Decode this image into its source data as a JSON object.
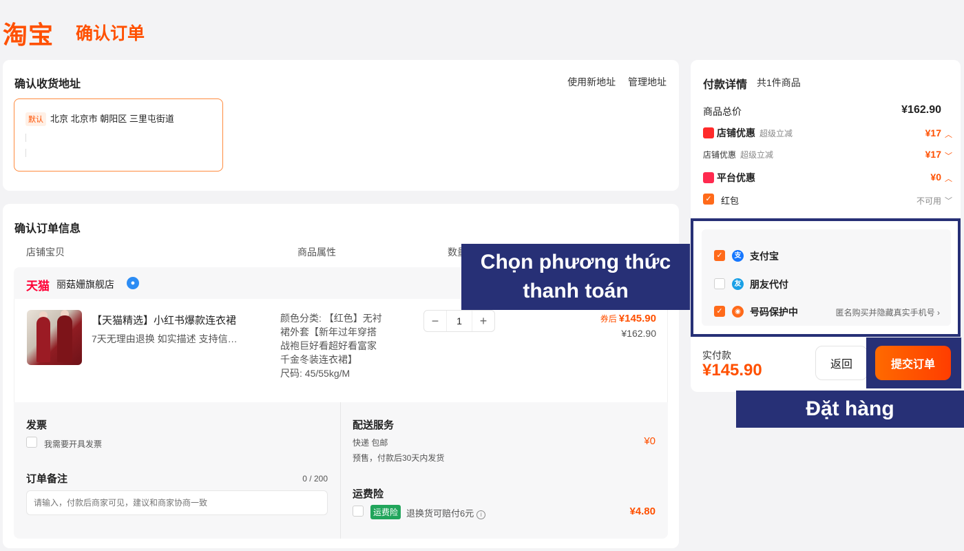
{
  "header": {
    "logo": "淘宝",
    "title": "确认订单"
  },
  "address": {
    "title": "确认收货地址",
    "links": [
      "使用新地址",
      "管理地址"
    ],
    "default_tag": "默认",
    "text": "北京 北京市 朝阳区 三里屯街道"
  },
  "order": {
    "title": "确认订单信息",
    "columns": [
      "店铺宝贝",
      "商品属性",
      "数量"
    ],
    "shop": {
      "brand": "天猫",
      "name": "丽菇姗旗舰店"
    },
    "item": {
      "title": "【天猫精选】小红书爆款连衣裙",
      "sub": "7天无理由退换  如实描述  支持信…",
      "attr_color": "颜色分类: 【红色】无衬裙外套【新年过年穿搭战袍巨好看超好看富家千金冬装连衣裙】",
      "attr_size": "尺码: 45/55kg/M",
      "qty": "1",
      "price_label": "券后",
      "price_new": "¥145.90",
      "price_old": "¥162.90"
    },
    "invoice": {
      "title": "发票",
      "option": "我需要开具发票"
    },
    "note": {
      "title": "订单备注",
      "counter": "0 / 200",
      "placeholder": "请输入，付款后商家可见，建议和商家协商一致"
    },
    "delivery": {
      "title": "配送服务",
      "method": "快递 包邮",
      "presale": "预售，付款后30天内发货",
      "price": "¥0"
    },
    "shipping_insurance": {
      "title": "运费险",
      "tag": "运费险",
      "desc": "退换货可赔付6元",
      "price": "¥4.80"
    }
  },
  "payment": {
    "title": "付款详情",
    "count": "共1件商品",
    "goods_total_label": "商品总价",
    "goods_total": "¥162.90",
    "shop_discount_label": "店铺优惠",
    "shop_discount_sub": "超级立减",
    "shop_discount": "¥17",
    "shop_discount_row_label": "店铺优惠",
    "shop_discount_row_sub": "超级立减",
    "shop_discount_row": "¥17",
    "platform_discount_label": "平台优惠",
    "platform_discount": "¥0",
    "redpacket_label": "红包",
    "redpacket_status": "不可用",
    "methods": [
      {
        "label": "支付宝",
        "checked": true
      },
      {
        "label": "朋友代付",
        "checked": false
      },
      {
        "label": "号码保护中",
        "checked": true,
        "extra": "匿名购买并隐藏真实手机号"
      }
    ],
    "actual_label": "实付款",
    "actual": "¥145.90",
    "back_label": "返回",
    "submit_label": "提交订单"
  },
  "callouts": {
    "pay_line1": "Chọn phương thức",
    "pay_line2": "thanh toán",
    "order": "Đặt hàng"
  },
  "colors": {
    "accent": "#ff5000",
    "callout": "#273076",
    "alipay": "#1677ff",
    "green": "#21a55b"
  }
}
